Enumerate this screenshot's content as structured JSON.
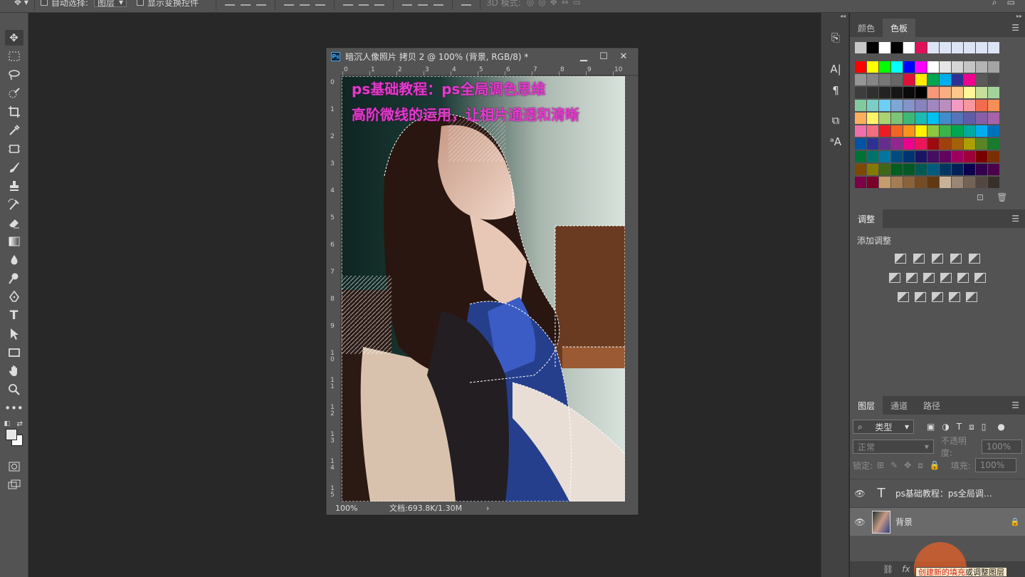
{
  "options_bar": {
    "auto_select_label": "自动选择:",
    "auto_select_target": "图层",
    "show_transform_label": "显示变换控件",
    "mode_3d_label": "3D 模式:"
  },
  "toolbar": {
    "tools": [
      "move-tool",
      "marquee-tool",
      "lasso-tool",
      "quick-select-tool",
      "crop-tool",
      "eyedropper-tool",
      "frame-tool",
      "brush-tool",
      "stamp-tool",
      "history-brush-tool",
      "eraser-tool",
      "gradient-tool",
      "blur-tool",
      "dodge-tool",
      "pen-tool",
      "type-tool",
      "path-select-tool",
      "rectangle-tool",
      "hand-tool",
      "zoom-tool",
      "more-tools"
    ]
  },
  "document": {
    "title": "暗沉人像照片 拷贝 2 @ 100% (背景, RGB/8) *",
    "ps_logo": "Ps",
    "ruler_h": [
      "0",
      "1",
      "2",
      "3",
      "4",
      "5",
      "6",
      "7",
      "8",
      "9",
      "10"
    ],
    "ruler_v": [
      "0",
      "1",
      "2",
      "3",
      "4",
      "5",
      "6",
      "7",
      "8",
      "9",
      "10",
      "11",
      "12",
      "13",
      "14",
      "15"
    ],
    "overlay_line1": "ps基础教程：ps全局调色思维",
    "overlay_line2": "高阶微线的运用，让相片通透和清晰",
    "zoom": "100%",
    "doc_info": "文档:693.8K/1.30M",
    "status_arrow": "›"
  },
  "colors": {
    "overlay_text": "#e03cc8",
    "panel_bg": "#535353",
    "canvas_bg": "#282828"
  },
  "panels": {
    "color_tab": "颜色",
    "swatch_tab": "色板",
    "adjust_tab": "调整",
    "adjust_label": "添加调整",
    "layers_tab": "图层",
    "channels_tab": "通道",
    "paths_tab": "路径",
    "filter_kind": "类型",
    "blend_mode": "正常",
    "opacity_label": "不透明度:",
    "opacity_value": "100%",
    "lock_label": "锁定:",
    "fill_label": "填充:",
    "fill_value": "100%",
    "menu_glyph": "☰",
    "layers": [
      {
        "type_glyph": "T",
        "name": "ps基础教程：ps全局调…",
        "lock": ""
      },
      {
        "type_glyph": "",
        "name": "背景",
        "lock": "🔒"
      }
    ],
    "tooltip_part1": "创建新",
    "tooltip_part2": "的填充",
    "tooltip_part3": "或调整图层"
  }
}
